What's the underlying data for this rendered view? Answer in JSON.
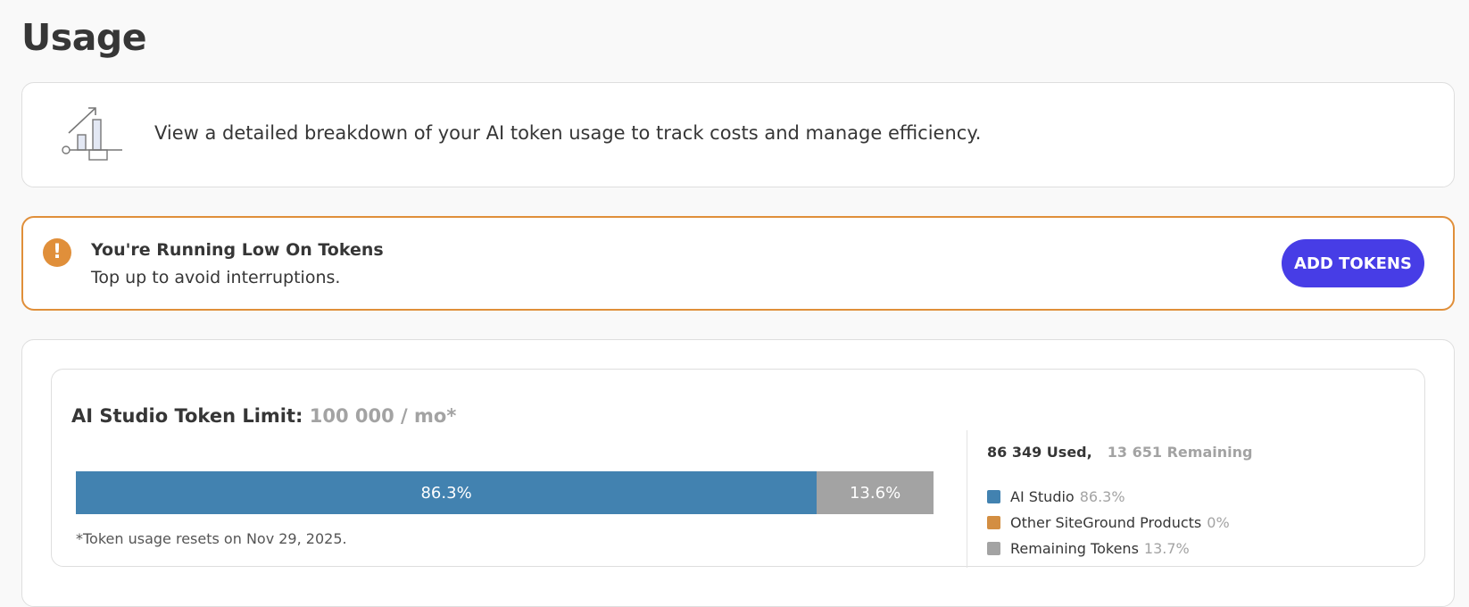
{
  "page": {
    "title": "Usage"
  },
  "intro": {
    "text": "View a detailed breakdown of your AI token usage to track costs and manage efficiency."
  },
  "alert": {
    "title": "You're Running Low On Tokens",
    "subtitle": "Top up to avoid interruptions.",
    "button_label": "ADD TOKENS",
    "icon_glyph": "!"
  },
  "usage": {
    "limit_label": "AI Studio Token Limit:",
    "limit_value": "100 000 / mo*",
    "used_text": "86 349 Used,",
    "remaining_text": "13 651 Remaining",
    "reset_note": "*Token usage resets on Nov 29, 2025.",
    "bar": {
      "segments": [
        {
          "label": "86.3%",
          "fraction": 0.863
        },
        {
          "label": "13.6%",
          "fraction": 0.136
        }
      ]
    },
    "legend": [
      {
        "label": "AI Studio",
        "pct": "86.3%",
        "color": "#4282b0"
      },
      {
        "label": "Other SiteGround Products",
        "pct": "0%",
        "color": "#d38e42"
      },
      {
        "label": "Remaining Tokens",
        "pct": "13.7%",
        "color": "#a3a3a3"
      }
    ]
  },
  "colors": {
    "accent_button": "#473de6",
    "warning": "#e08f3a",
    "ai_studio": "#4282b0",
    "other_products": "#d38e42",
    "remaining": "#a3a3a3"
  },
  "icons": {
    "intro": "chart-growth-icon",
    "alert": "exclamation-circle-icon"
  }
}
